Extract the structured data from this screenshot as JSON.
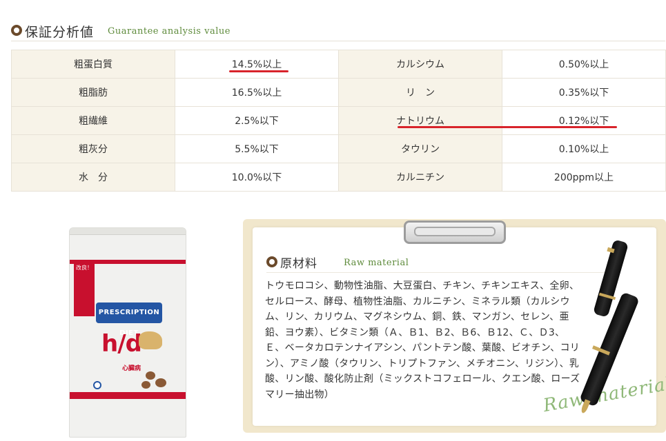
{
  "guarantee": {
    "title": "保証分析値",
    "subtitle": "Guarantee analysis value",
    "rows": [
      {
        "label1": "粗蛋白質",
        "value1": "14.5%以上",
        "label2": "カルシウム",
        "value2": "0.50%以上"
      },
      {
        "label1": "粗脂肪",
        "value1": "16.5%以上",
        "label2": "リ　ン",
        "value2": "0.35%以下"
      },
      {
        "label1": "粗繊維",
        "value1": "2.5%以下",
        "label2": "ナトリウム",
        "value2": "0.12%以下"
      },
      {
        "label1": "粗灰分",
        "value1": "5.5%以下",
        "label2": "タウリン",
        "value2": "0.10%以上"
      },
      {
        "label1": "水　分",
        "value1": "10.0%以下",
        "label2": "カルニチン",
        "value2": "200ppm以上"
      }
    ]
  },
  "product": {
    "badge": "改良！",
    "brand": "PRESCRIPTION DIET",
    "name": "h/d",
    "category": "心臓病"
  },
  "raw_material": {
    "title": "原材料",
    "subtitle": "Raw material",
    "text": "トウモロコシ、動物性油脂、大豆蛋白、チキン、チキンエキス、全卵、セルロース、酵母、植物性油脂、カルニチン、ミネラル類（カルシウム、リン、カリウム、マグネシウム、銅、鉄、マンガン、セレン、亜鉛、ヨウ素）、ビタミン類（Ａ、Ｂ1、Ｂ2、Ｂ6、Ｂ12、Ｃ、Ｄ3、Ｅ、ベータカロテンナイアシン、パントテン酸、葉酸、ビオチン、コリン）、アミノ酸（タウリン、トリプトファン、メチオニン、リジン）、乳酸、リン酸、酸化防止剤（ミックストコフェロール、クエン酸、ローズマリー抽出物）",
    "script": "Raw material"
  },
  "colors": {
    "accent_green": "#5d8a3a",
    "ring_brown": "#6b4a2b",
    "highlight_red": "#d8232a",
    "label_bg": "#f7f3e8"
  }
}
